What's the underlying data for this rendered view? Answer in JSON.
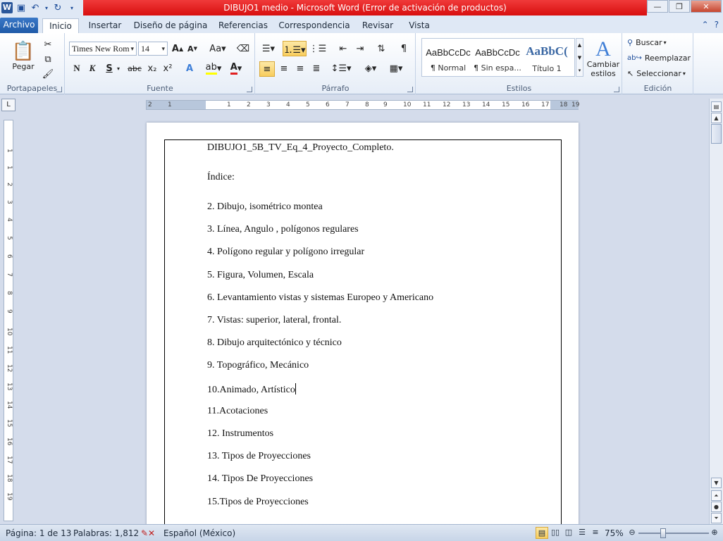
{
  "window": {
    "title": "DIBUJO1 medio  -  Microsoft Word (Error de activación de productos)"
  },
  "tabs": [
    "Archivo",
    "Inicio",
    "Insertar",
    "Diseño de página",
    "Referencias",
    "Correspondencia",
    "Revisar",
    "Vista"
  ],
  "ribbon": {
    "paste_label": "Pegar",
    "font_name": "Times New Rom",
    "font_size": "14",
    "bold": "N",
    "italic": "K",
    "underline": "S",
    "strike": "abc",
    "subscript": "x₂",
    "superscript": "x²",
    "change_case": "Aa",
    "styles": [
      {
        "preview": "AaBbCcDc",
        "name": "¶ Normal"
      },
      {
        "preview": "AaBbCcDc",
        "name": "¶ Sin espa..."
      },
      {
        "preview": "AaBbC(",
        "name": "Título 1"
      }
    ],
    "change_styles": [
      "Cambiar",
      "estilos"
    ],
    "find": "Buscar",
    "replace": "Reemplazar",
    "select": "Seleccionar",
    "groups": [
      "Portapapeles",
      "Fuente",
      "Párrafo",
      "Estilos",
      "Edición"
    ]
  },
  "ruler": {
    "ticks": [
      "2",
      "1",
      "1",
      "2",
      "3",
      "4",
      "5",
      "6",
      "7",
      "8",
      "9",
      "10",
      "11",
      "12",
      "13",
      "14",
      "15",
      "16",
      "17",
      "18",
      "19"
    ],
    "vticks": [
      "1",
      "1",
      "2",
      "3",
      "4",
      "5",
      "6",
      "7",
      "8",
      "9",
      "10",
      "11",
      "12",
      "13",
      "14",
      "15",
      "16",
      "17",
      "18",
      "19"
    ]
  },
  "document": {
    "lines": [
      "DIBUJO1_5B_TV_Eq_4_Proyecto_Completo.",
      "Índice:",
      "2.  Dibujo, isométrico montea",
      "3.  Línea, Angulo , polígonos regulares",
      "4.  Polígono regular y polígono irregular",
      "5.  Figura, Volumen, Escala",
      "6.  Levantamiento vistas y sistemas Europeo y Americano",
      "7.  Vistas: superior, lateral, frontal.",
      "8.  Dibujo arquitectónico y técnico",
      "9.  Topográfico, Mecánico",
      "10.Animado, Artístico",
      "11.Acotaciones",
      "12.  Instrumentos",
      "13.  Tipos de Proyecciones",
      "14.  Tipos De Proyecciones",
      "15.Tipos de Proyecciones"
    ]
  },
  "status": {
    "page": "Página: 1 de 13",
    "words": "Palabras: 1,812",
    "language": "Español (México)",
    "zoom": "75%"
  }
}
